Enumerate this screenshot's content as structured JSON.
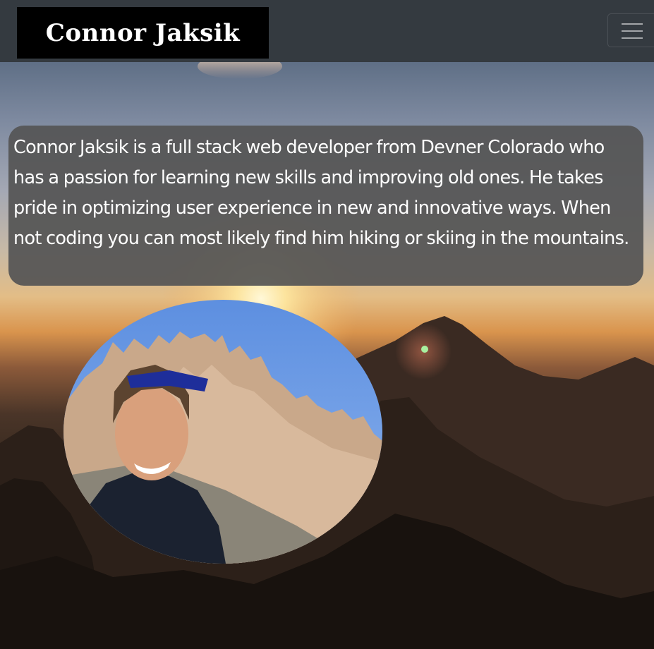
{
  "navbar": {
    "brand": "Connor Jaksik",
    "toggler_icon": "hamburger-menu-icon"
  },
  "about": {
    "text": "Connor Jaksik is a full stack web developer from Devner Colorado who has a passion for learning new skills and improving old ones. He takes pride in optimizing user experience in new and innovative ways. When not coding you can most likely find him hiking or skiing in the mountains."
  },
  "colors": {
    "navbar_bg": "#343a40",
    "brand_bg": "#000000",
    "brand_text": "#ffffff",
    "about_bg": "#555555",
    "about_text": "#ffffff"
  }
}
